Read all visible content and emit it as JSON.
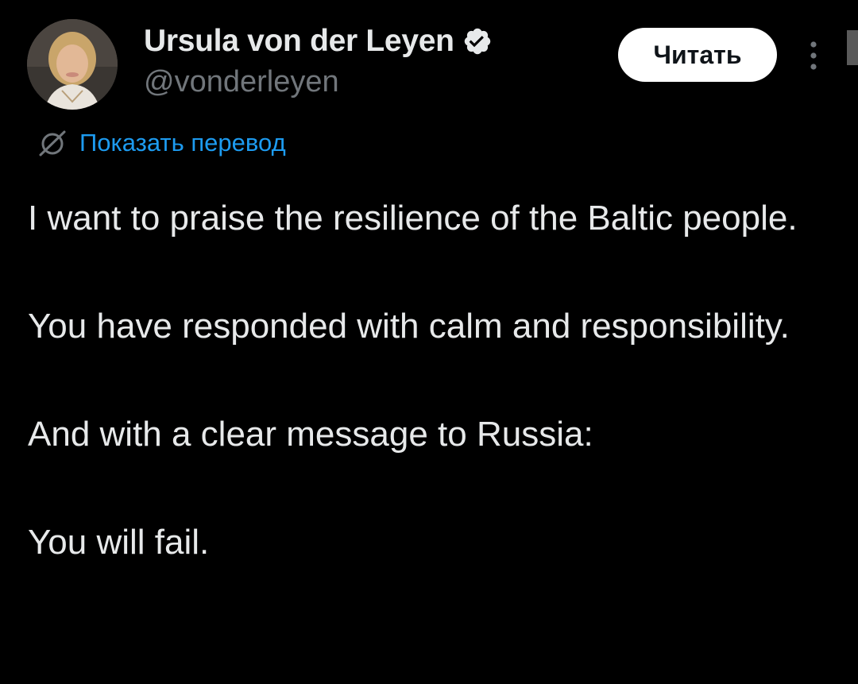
{
  "author": {
    "display_name": "Ursula von der Leyen",
    "handle": "@vonderleyen",
    "verified": true
  },
  "actions": {
    "follow_label": "Читать",
    "more_icon": "more-vertical-icon"
  },
  "translate": {
    "icon": "globe-icon",
    "label": "Показать перевод"
  },
  "tweet": {
    "paragraphs": [
      "I want to praise the resilience of the Baltic people.",
      "You have responded with calm and responsibility.",
      "And with a clear message to Russia:",
      "You will fail."
    ]
  },
  "colors": {
    "background": "#000000",
    "primary_text": "#e7e9ea",
    "secondary_text": "#71767b",
    "link": "#1d9bf0",
    "follow_button_bg": "#ffffff",
    "follow_button_text": "#0f1419"
  }
}
